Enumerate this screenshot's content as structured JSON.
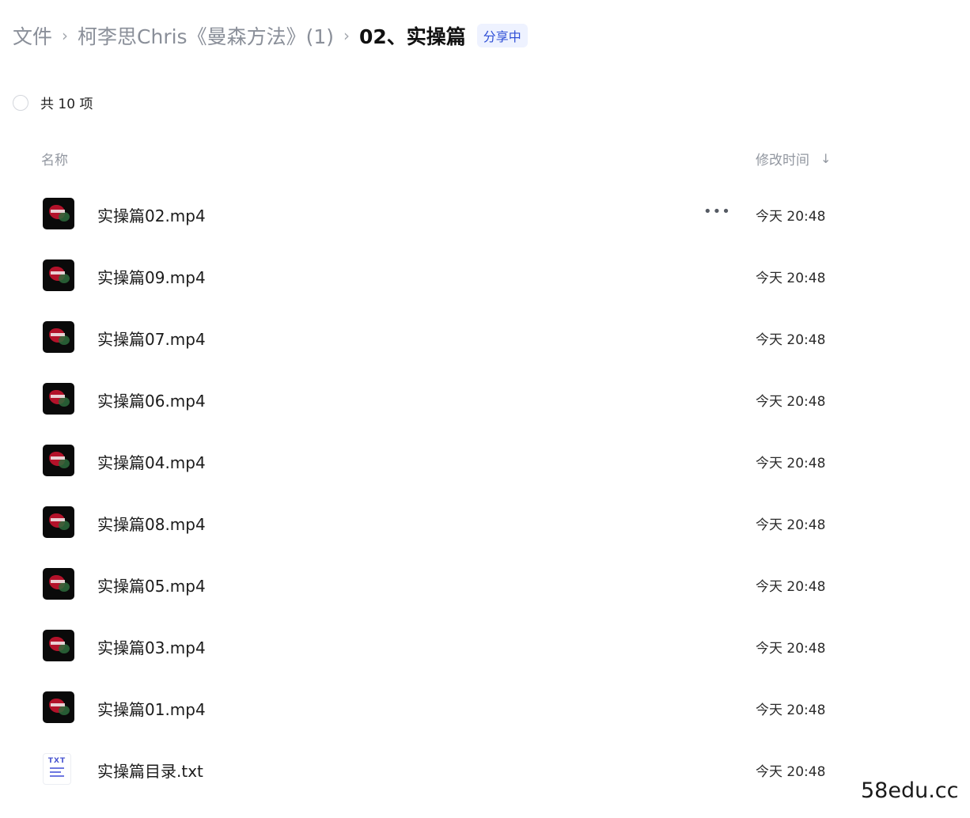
{
  "breadcrumb": {
    "root": "文件",
    "parent": "柯李思Chris《曼森方法》(1)",
    "current": "02、实操篇",
    "separator": "›",
    "share_badge": "分享中"
  },
  "summary": {
    "count_text": "共 10 项"
  },
  "columns": {
    "name": "名称",
    "modified": "修改时间",
    "sort_icon": "arrow-down-icon",
    "sort_glyph": "↓"
  },
  "files": [
    {
      "name": "实操篇02.mp4",
      "modified": "今天 20:48",
      "type": "video",
      "show_more": true
    },
    {
      "name": "实操篇09.mp4",
      "modified": "今天 20:48",
      "type": "video"
    },
    {
      "name": "实操篇07.mp4",
      "modified": "今天 20:48",
      "type": "video"
    },
    {
      "name": "实操篇06.mp4",
      "modified": "今天 20:48",
      "type": "video"
    },
    {
      "name": "实操篇04.mp4",
      "modified": "今天 20:48",
      "type": "video"
    },
    {
      "name": "实操篇08.mp4",
      "modified": "今天 20:48",
      "type": "video"
    },
    {
      "name": "实操篇05.mp4",
      "modified": "今天 20:48",
      "type": "video"
    },
    {
      "name": "实操篇03.mp4",
      "modified": "今天 20:48",
      "type": "video"
    },
    {
      "name": "实操篇01.mp4",
      "modified": "今天 20:48",
      "type": "video"
    },
    {
      "name": "实操篇目录.txt",
      "modified": "今天 20:48",
      "type": "txt"
    }
  ],
  "icons": {
    "more": "more-horizontal-icon",
    "more_glyph": "•••",
    "txt_label": "TXT"
  },
  "watermark": "58edu.cc",
  "colors": {
    "share_badge_text": "#2f4fd6",
    "muted_text": "#8a8f99"
  }
}
